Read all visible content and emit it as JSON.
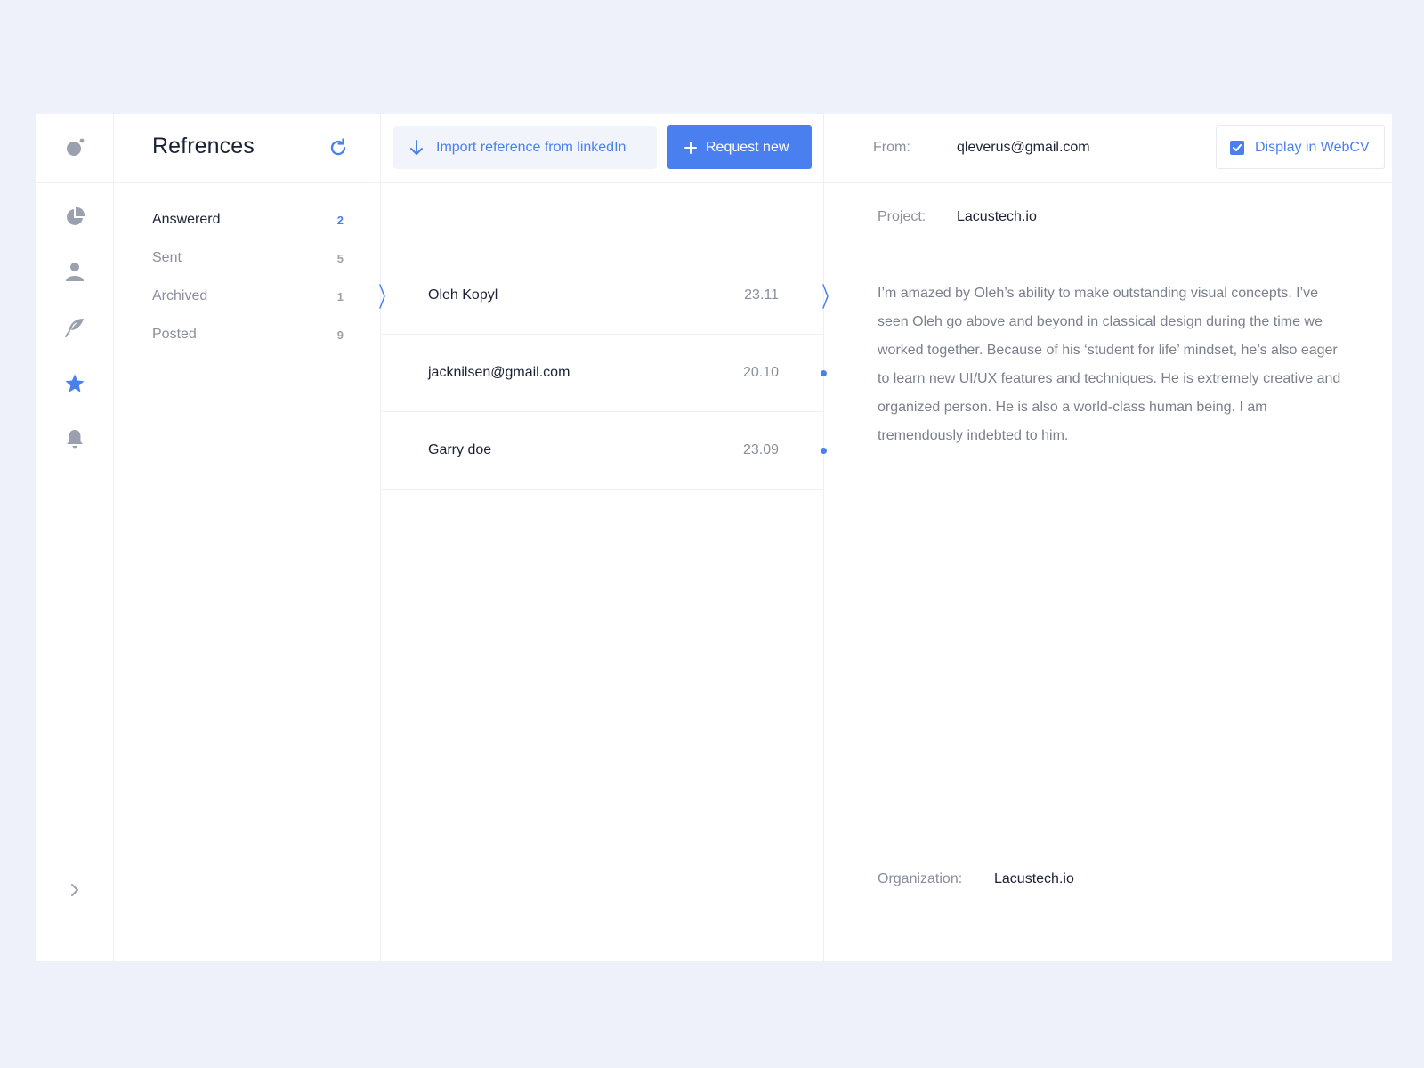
{
  "theme": {
    "accent": "#4a7ff0",
    "icon_muted": "#9aa0ad",
    "background": "#eff1fa",
    "panel": "#ffffff"
  },
  "rail": {
    "icons": [
      "logo-icon",
      "pie-chart-icon",
      "user-icon",
      "feather-icon",
      "star-icon",
      "bell-icon",
      "chevron-right-icon"
    ],
    "active": "star-icon"
  },
  "categories": {
    "title": "Refrences",
    "items": [
      {
        "label": "Answererd",
        "count": "2",
        "active": true
      },
      {
        "label": "Sent",
        "count": "5",
        "active": false
      },
      {
        "label": "Archived",
        "count": "1",
        "active": false
      },
      {
        "label": "Posted",
        "count": "9",
        "active": false
      }
    ]
  },
  "toolbar": {
    "import_label": "Import reference from linkedIn",
    "request_label": "Request new"
  },
  "references": [
    {
      "name": "Oleh Kopyl",
      "date": "23.11",
      "selected": true,
      "unread": false
    },
    {
      "name": "jacknilsen@gmail.com",
      "date": "20.10",
      "selected": false,
      "unread": true
    },
    {
      "name": "Garry doe",
      "date": "23.09",
      "selected": false,
      "unread": true
    }
  ],
  "detail": {
    "from_label": "From:",
    "from_value": "qleverus@gmail.com",
    "display_toggle_label": "Display in WebCV",
    "display_toggle_checked": true,
    "project_label": "Project:",
    "project_value": "Lacustech.io",
    "text": "I’m amazed by Oleh’s ability to make outstanding visual concepts. I’ve seen Oleh go above and beyond in classical design during the time we worked together. Because of his ‘student for life’ mindset, he’s also eager to learn new UI/UX features and techniques. He is extremely creative and organized person. He is also a world-class human being. I am tremendously indebted to him.",
    "organization_label": "Organization:",
    "organization_value": "Lacustech.io"
  }
}
